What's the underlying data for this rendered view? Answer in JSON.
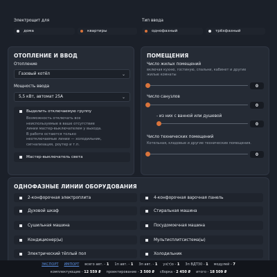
{
  "shield": {
    "label": "Электрощит для",
    "options": [
      {
        "label": "дома",
        "selected": false
      },
      {
        "label": "квартиры",
        "selected": true
      }
    ]
  },
  "input_type": {
    "label": "Тип ввода",
    "options": [
      {
        "label": "однофазный",
        "selected": true
      },
      {
        "label": "трёхфазный",
        "selected": false
      }
    ]
  },
  "heating": {
    "title": "ОТОПЛЕНИЕ И ВВОД",
    "heating_label": "Отопление",
    "heating_value": "Газовый котёл",
    "power_label": "Мощность ввода",
    "power_value": "5,5 кВт, автомат 25А",
    "group_label": "Выделить отключаемую группу",
    "group_desc": "Возможность отключать все неиспользуемые в ваше отсутствие линии мастер-выключателем у выхода. В работе остаются только неотключаемые линии — холодильник, сигнализация, роутер и т.п.",
    "master_label": "Мастер-выключатель света"
  },
  "rooms": {
    "title": "ПОМЕЩЕНИЯ",
    "living_label": "Число жилых помещений",
    "living_desc": "включая кухню, гостиную, спальни, кабинет и другие жилые комнаты",
    "living_value": "0",
    "bath_label": "Число санузлов",
    "bath_value": "0",
    "shower_label": "- из них с ванной или душевой",
    "shower_value": "0",
    "tech_label": "Число технических помещений",
    "tech_desc": "Котельная, кладовые и другие технические помещения.",
    "tech_value": "0"
  },
  "equipment": {
    "title": "ОДНОФАЗНЫЕ ЛИНИИ ОБОРУДОВАНИЯ",
    "left": [
      "2-конфорочная электроплита",
      "Духовой шкаф",
      "Сушильная машина",
      "Кондиционер(ы)",
      "Электрический тёплый пол"
    ],
    "right": [
      "4-конфорочная варочная панель",
      "Стиральная машина",
      "Посудомоечная машина",
      "Мультисплитсистема(ы)",
      "Холодильник"
    ]
  },
  "footer": {
    "export": "ЭКСПОРТ",
    "import": "ИМПОРТ",
    "stats": [
      {
        "label": "всего авт. -",
        "value": "1"
      },
      {
        "label": "1п авт. -",
        "value": "1"
      },
      {
        "label": "3п авт. -",
        "value": "1"
      },
      {
        "label": "уз(т)о -",
        "value": "1"
      },
      {
        "label": "3п ВДТ30 -",
        "value": "1"
      },
      {
        "label": "модулей -",
        "value": "7"
      }
    ],
    "totals": [
      {
        "label": "комплектующие -",
        "value": "12 559 ₽"
      },
      {
        "label": "проектирование -",
        "value": "3 500 ₽"
      },
      {
        "label": "сборка -",
        "value": "2 450 ₽"
      },
      {
        "label": "итого -",
        "value": "18 509 ₽"
      }
    ]
  },
  "colors": {
    "accent": "#d9743c",
    "background": "#1b2029",
    "card": "#252b35"
  }
}
